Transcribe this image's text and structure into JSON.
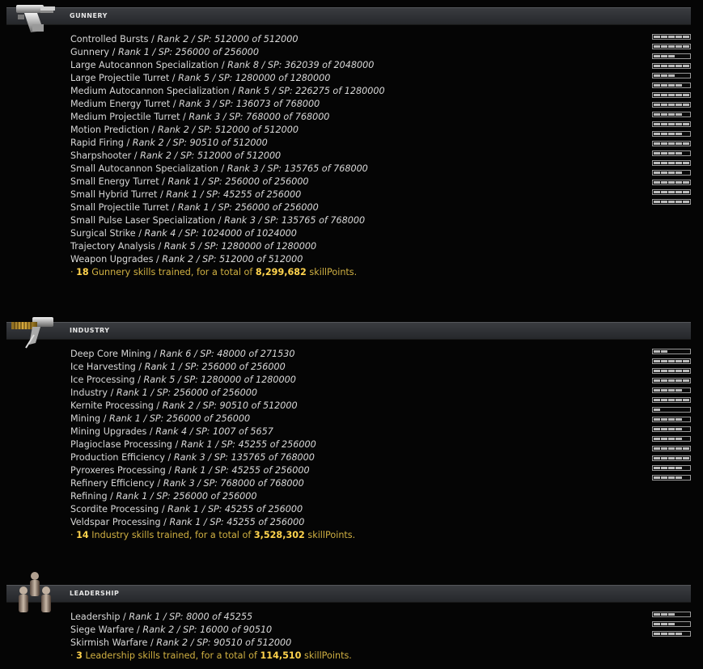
{
  "sections": [
    {
      "id": "gunnery",
      "title": "GUNNERY",
      "icon": "turret-icon",
      "skills": [
        {
          "name": "Controlled Bursts",
          "rank": "Rank 2",
          "sp": "SP: 512000 of 512000",
          "level": 5
        },
        {
          "name": "Gunnery",
          "rank": "Rank 1",
          "sp": "SP: 256000 of 256000",
          "level": 5
        },
        {
          "name": "Large Autocannon Specialization",
          "rank": "Rank 8",
          "sp": "SP: 362039 of 2048000",
          "level": 3
        },
        {
          "name": "Large Projectile Turret",
          "rank": "Rank 5",
          "sp": "SP: 1280000 of 1280000",
          "level": 5
        },
        {
          "name": "Medium Autocannon Specialization",
          "rank": "Rank 5",
          "sp": "SP: 226275 of 1280000",
          "level": 3
        },
        {
          "name": "Medium Energy Turret",
          "rank": "Rank 3",
          "sp": "SP: 136073 of 768000",
          "level": 4
        },
        {
          "name": "Medium Projectile Turret",
          "rank": "Rank 3",
          "sp": "SP: 768000 of 768000",
          "level": 5
        },
        {
          "name": "Motion Prediction",
          "rank": "Rank 2",
          "sp": "SP: 512000 of 512000",
          "level": 5
        },
        {
          "name": "Rapid Firing",
          "rank": "Rank 2",
          "sp": "SP: 90510 of 512000",
          "level": 4
        },
        {
          "name": "Sharpshooter",
          "rank": "Rank 2",
          "sp": "SP: 512000 of 512000",
          "level": 5
        },
        {
          "name": "Small Autocannon Specialization",
          "rank": "Rank 3",
          "sp": "SP: 135765 of 768000",
          "level": 4
        },
        {
          "name": "Small Energy Turret",
          "rank": "Rank 1",
          "sp": "SP: 256000 of 256000",
          "level": 5
        },
        {
          "name": "Small Hybrid Turret",
          "rank": "Rank 1",
          "sp": "SP: 45255 of 256000",
          "level": 4
        },
        {
          "name": "Small Projectile Turret",
          "rank": "Rank 1",
          "sp": "SP: 256000 of 256000",
          "level": 5
        },
        {
          "name": "Small Pulse Laser Specialization",
          "rank": "Rank 3",
          "sp": "SP: 135765 of 768000",
          "level": 4
        },
        {
          "name": "Surgical Strike",
          "rank": "Rank 4",
          "sp": "SP: 1024000 of 1024000",
          "level": 5
        },
        {
          "name": "Trajectory Analysis",
          "rank": "Rank 5",
          "sp": "SP: 1280000 of 1280000",
          "level": 5
        },
        {
          "name": "Weapon Upgrades",
          "rank": "Rank 2",
          "sp": "SP: 512000 of 512000",
          "level": 5
        }
      ],
      "summary": {
        "prefix": "·",
        "count": "18",
        "text": " Gunnery skills trained, for a total of ",
        "total": "8,299,682",
        "suffix": " skillPoints."
      }
    },
    {
      "id": "industry",
      "title": "INDUSTRY",
      "icon": "mining-laser-icon",
      "skills": [
        {
          "name": "Deep Core Mining",
          "rank": "Rank 6",
          "sp": "SP: 48000 of 271530",
          "level": 2
        },
        {
          "name": "Ice Harvesting",
          "rank": "Rank 1",
          "sp": "SP: 256000 of 256000",
          "level": 5
        },
        {
          "name": "Ice Processing",
          "rank": "Rank 5",
          "sp": "SP: 1280000 of 1280000",
          "level": 5
        },
        {
          "name": "Industry",
          "rank": "Rank 1",
          "sp": "SP: 256000 of 256000",
          "level": 5
        },
        {
          "name": "Kernite Processing",
          "rank": "Rank 2",
          "sp": "SP: 90510 of 512000",
          "level": 4
        },
        {
          "name": "Mining",
          "rank": "Rank 1",
          "sp": "SP: 256000 of 256000",
          "level": 5
        },
        {
          "name": "Mining Upgrades",
          "rank": "Rank 4",
          "sp": "SP: 1007 of 5657",
          "level": 1
        },
        {
          "name": "Plagioclase Processing",
          "rank": "Rank 1",
          "sp": "SP: 45255 of 256000",
          "level": 4
        },
        {
          "name": "Production Efficiency",
          "rank": "Rank 3",
          "sp": "SP: 135765 of 768000",
          "level": 4
        },
        {
          "name": "Pyroxeres Processing",
          "rank": "Rank 1",
          "sp": "SP: 45255 of 256000",
          "level": 4
        },
        {
          "name": "Refinery Efficiency",
          "rank": "Rank 3",
          "sp": "SP: 768000 of 768000",
          "level": 5
        },
        {
          "name": "Refining",
          "rank": "Rank 1",
          "sp": "SP: 256000 of 256000",
          "level": 5
        },
        {
          "name": "Scordite Processing",
          "rank": "Rank 1",
          "sp": "SP: 45255 of 256000",
          "level": 4
        },
        {
          "name": "Veldspar Processing",
          "rank": "Rank 1",
          "sp": "SP: 45255 of 256000",
          "level": 4
        }
      ],
      "summary": {
        "prefix": "·",
        "count": "14",
        "text": " Industry skills trained, for a total of ",
        "total": "3,528,302",
        "suffix": " skillPoints."
      }
    },
    {
      "id": "leadership",
      "title": "LEADERSHIP",
      "icon": "leadership-figures-icon",
      "skills": [
        {
          "name": "Leadership",
          "rank": "Rank 1",
          "sp": "SP: 8000 of 45255",
          "level": 3
        },
        {
          "name": "Siege Warfare",
          "rank": "Rank 2",
          "sp": "SP: 16000 of 90510",
          "level": 3
        },
        {
          "name": "Skirmish Warfare",
          "rank": "Rank 2",
          "sp": "SP: 90510 of 512000",
          "level": 4
        }
      ],
      "summary": {
        "prefix": "·",
        "count": "3",
        "text": " Leadership skills trained, for a total of ",
        "total": "114,510",
        "suffix": " skillPoints."
      }
    }
  ]
}
